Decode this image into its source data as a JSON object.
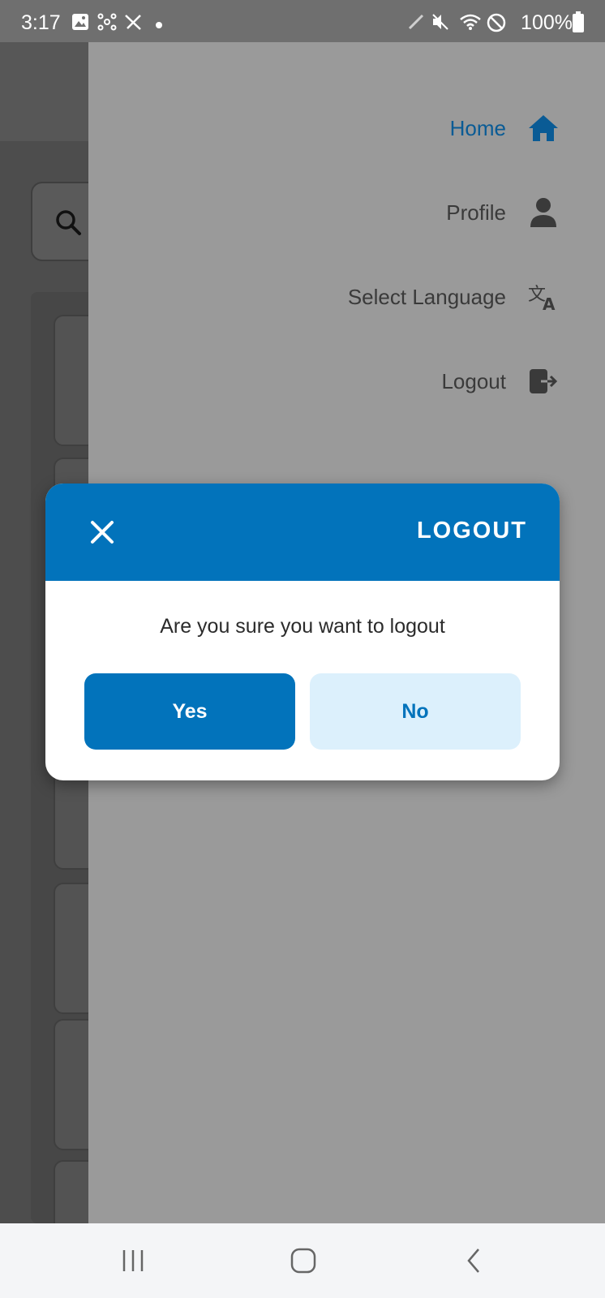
{
  "status_bar": {
    "time": "3:17",
    "battery": "100%",
    "left_icons": [
      "gallery-icon",
      "network-icon",
      "no-edit-icon",
      "dot-icon"
    ],
    "right_icons": [
      "pen-icon",
      "mute-icon",
      "wifi-icon",
      "dnd-icon",
      "battery-icon"
    ]
  },
  "drawer": {
    "items": [
      {
        "label": "Home",
        "icon": "home-icon",
        "active": true
      },
      {
        "label": "Profile",
        "icon": "person-icon",
        "active": false
      },
      {
        "label": "Select Language",
        "icon": "translate-icon",
        "active": false
      },
      {
        "label": "Logout",
        "icon": "logout-icon",
        "active": false
      }
    ]
  },
  "dialog": {
    "title": "LOGOUT",
    "message": "Are you sure you want to logout",
    "yes_label": "Yes",
    "no_label": "No"
  },
  "colors": {
    "primary": "#0273bb",
    "secondary_button": "#dcf0fc",
    "active_menu": "#0a5b95"
  },
  "nav_bar": {
    "buttons": [
      "recents-icon",
      "home-icon",
      "back-icon"
    ]
  }
}
